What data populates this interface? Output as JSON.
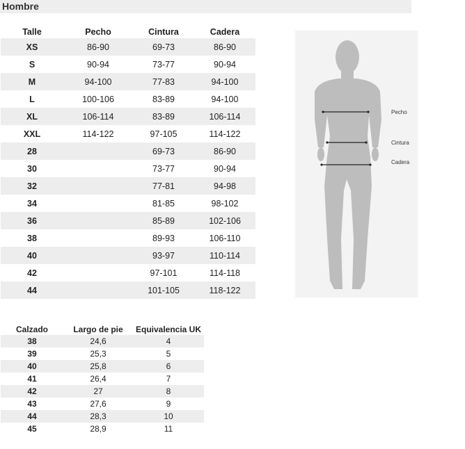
{
  "title": "Hombre",
  "size_table": {
    "headers": [
      "Talle",
      "Pecho",
      "Cintura",
      "Cadera"
    ],
    "rows": [
      [
        "XS",
        "86-90",
        "69-73",
        "86-90"
      ],
      [
        "S",
        "90-94",
        "73-77",
        "90-94"
      ],
      [
        "M",
        "94-100",
        "77-83",
        "94-100"
      ],
      [
        "L",
        "100-106",
        "83-89",
        "94-100"
      ],
      [
        "XL",
        "106-114",
        "83-89",
        "106-114"
      ],
      [
        "XXL",
        "114-122",
        "97-105",
        "114-122"
      ],
      [
        "28",
        "",
        "69-73",
        "86-90"
      ],
      [
        "30",
        "",
        "73-77",
        "90-94"
      ],
      [
        "32",
        "",
        "77-81",
        "94-98"
      ],
      [
        "34",
        "",
        "81-85",
        "98-102"
      ],
      [
        "36",
        "",
        "85-89",
        "102-106"
      ],
      [
        "38",
        "",
        "89-93",
        "106-110"
      ],
      [
        "40",
        "",
        "93-97",
        "110-114"
      ],
      [
        "42",
        "",
        "97-101",
        "114-118"
      ],
      [
        "44",
        "",
        "101-105",
        "118-122"
      ]
    ]
  },
  "shoe_table": {
    "headers": [
      "Calzado",
      "Largo de pie",
      "Equivalencia UK"
    ],
    "rows": [
      [
        "38",
        "24,6",
        "4"
      ],
      [
        "39",
        "25,3",
        "5"
      ],
      [
        "40",
        "25,8",
        "6"
      ],
      [
        "41",
        "26,4",
        "7"
      ],
      [
        "42",
        "27",
        "8"
      ],
      [
        "43",
        "27,6",
        "9"
      ],
      [
        "44",
        "28,3",
        "10"
      ],
      [
        "45",
        "28,9",
        "11"
      ]
    ]
  },
  "figure": {
    "labels": {
      "chest": "Pecho",
      "waist": "Cintura",
      "hip": "Cadera"
    },
    "body_color": "#bdbdbd",
    "background_color": "#f3f3f3"
  }
}
